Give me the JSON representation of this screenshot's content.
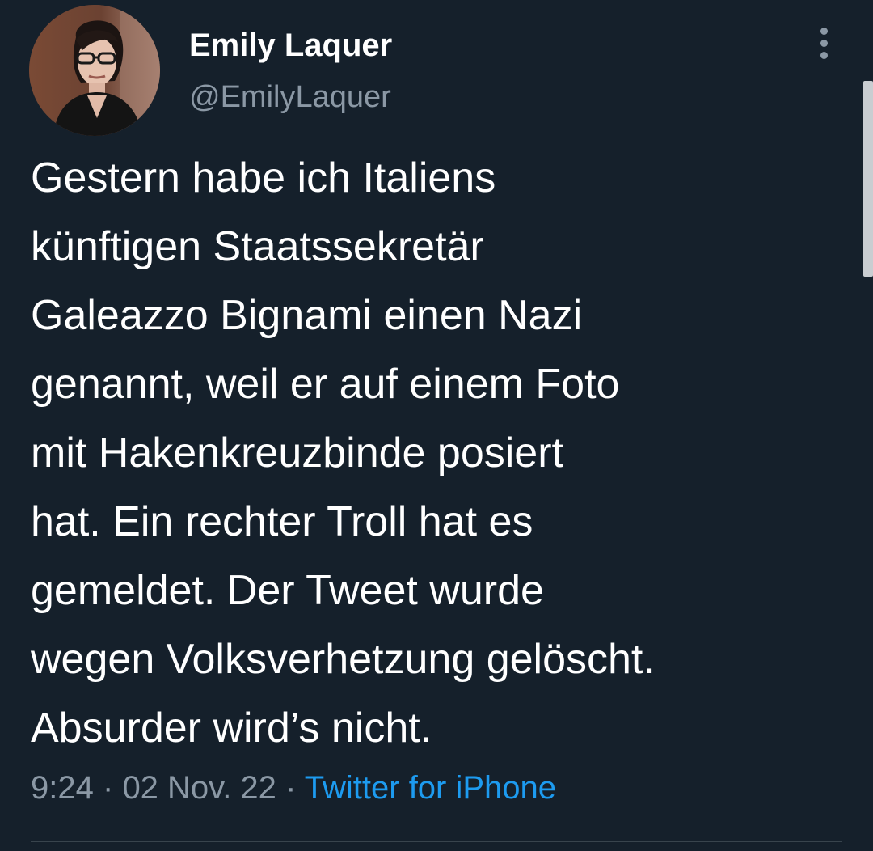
{
  "tweet": {
    "author": {
      "name": "Emily Laquer",
      "handle": "@EmilyLaquer"
    },
    "text": "Gestern habe ich Italiens\nkünftigen Staatssekretär\nGaleazzo Bignami einen Nazi\ngenannt, weil er auf einem Foto\nmit Hakenkreuzbinde posiert\nhat. Ein rechter Troll hat es\ngemeldet. Der Tweet wurde\nwegen Volksverhetzung gelöscht.\nAbsurder wird’s nicht.",
    "time": "9:24",
    "separator": "·",
    "date": "02 Nov. 22",
    "source": "Twitter for iPhone"
  },
  "icons": {
    "more": "more-vertical-icon"
  },
  "colors": {
    "background": "#15202b",
    "secondary_text": "#8b98a5",
    "link": "#1d9bf0"
  }
}
